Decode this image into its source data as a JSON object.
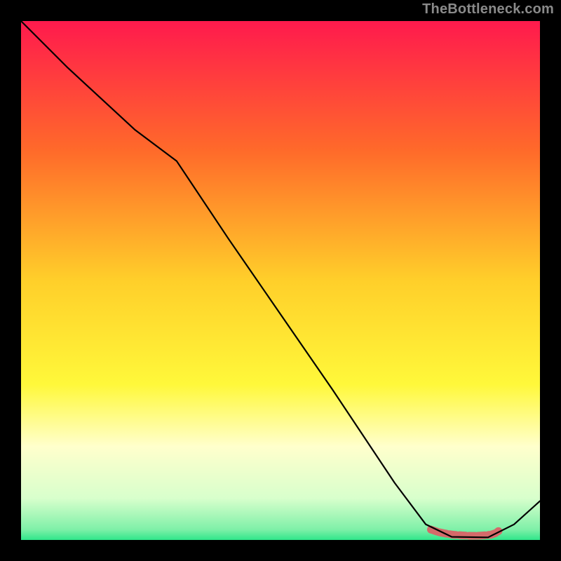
{
  "watermark": "TheBottleneck.com",
  "chart_data": {
    "type": "line",
    "title": "",
    "xlabel": "",
    "ylabel": "",
    "xlim": [
      0,
      100
    ],
    "ylim": [
      0,
      100
    ],
    "background_gradient": {
      "stops": [
        {
          "offset": 0.0,
          "color": "#ff1a4d"
        },
        {
          "offset": 0.25,
          "color": "#ff6a2a"
        },
        {
          "offset": 0.5,
          "color": "#ffcf2a"
        },
        {
          "offset": 0.7,
          "color": "#fff83a"
        },
        {
          "offset": 0.82,
          "color": "#ffffcc"
        },
        {
          "offset": 0.92,
          "color": "#d8ffcc"
        },
        {
          "offset": 0.98,
          "color": "#7ef0a8"
        },
        {
          "offset": 1.0,
          "color": "#2fe68a"
        }
      ]
    },
    "series": [
      {
        "name": "curve",
        "color": "#000000",
        "width": 2.2,
        "x": [
          0.0,
          9.0,
          22.0,
          30.0,
          40.0,
          50.0,
          60.0,
          72.0,
          78.0,
          83.0,
          90.0,
          95.0,
          100.0
        ],
        "values": [
          100.0,
          91.0,
          79.0,
          73.0,
          58.0,
          43.5,
          29.0,
          11.0,
          3.0,
          0.6,
          0.5,
          3.0,
          7.5
        ]
      }
    ],
    "markers": [
      {
        "name": "flat-marker",
        "color": "#d46a6a",
        "radius": 5.5,
        "x": [
          79.0,
          80.5,
          82.0,
          83.3,
          84.8,
          86.4,
          88.0,
          89.4,
          90.5,
          91.4,
          92.0
        ],
        "values": [
          2.0,
          1.5,
          1.2,
          1.0,
          0.9,
          0.8,
          0.8,
          0.9,
          1.0,
          1.3,
          1.7
        ]
      }
    ]
  }
}
